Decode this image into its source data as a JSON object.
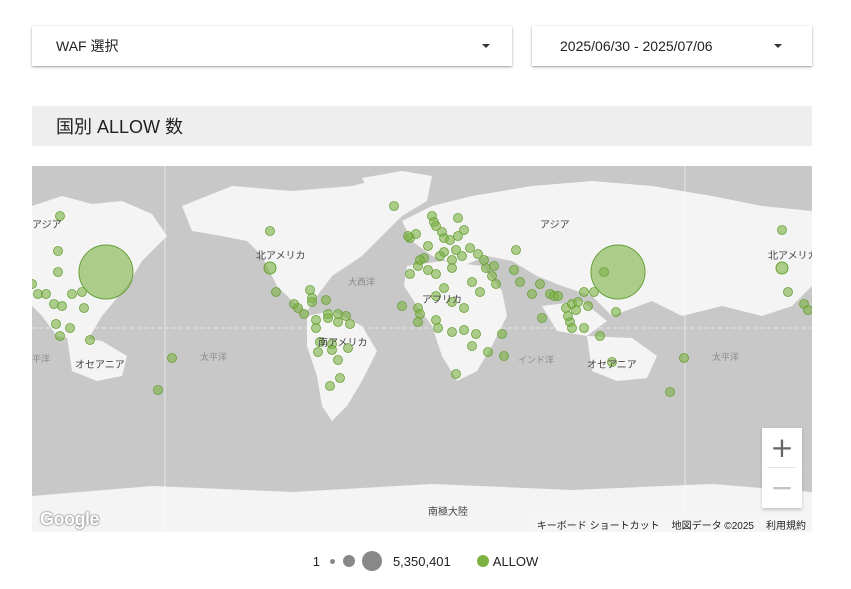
{
  "filters": {
    "waf_label": "WAF 選択",
    "date_range": "2025/06/30 - 2025/07/06"
  },
  "chart_title": "国別 ALLOW 数",
  "map": {
    "labels": {
      "asia": "アジア",
      "north_america": "北アメリカ",
      "south_america": "南アメリカ",
      "africa": "アフリカ",
      "oceania": "オセアニア",
      "antarctica": "南極大陸",
      "atlantic": "大西洋",
      "pacific": "太平洋",
      "indian": "インド洋",
      "pacific_partial": "平洋"
    },
    "zoom_in": "+",
    "zoom_out": "−",
    "logo": "Google",
    "attribution": {
      "shortcuts": "キーボード ショートカット",
      "map_data": "地図データ ©2025",
      "terms": "利用規約"
    }
  },
  "legend": {
    "min_value": "1",
    "max_value": "5,350,401",
    "series_name": "ALLOW",
    "series_color": "#7cb342"
  },
  "chart_data": {
    "type": "bubble-map",
    "metric": "ALLOW",
    "size_range": [
      1,
      5350401
    ],
    "series": [
      {
        "name": "ALLOW",
        "color": "#7cb342"
      }
    ]
  }
}
